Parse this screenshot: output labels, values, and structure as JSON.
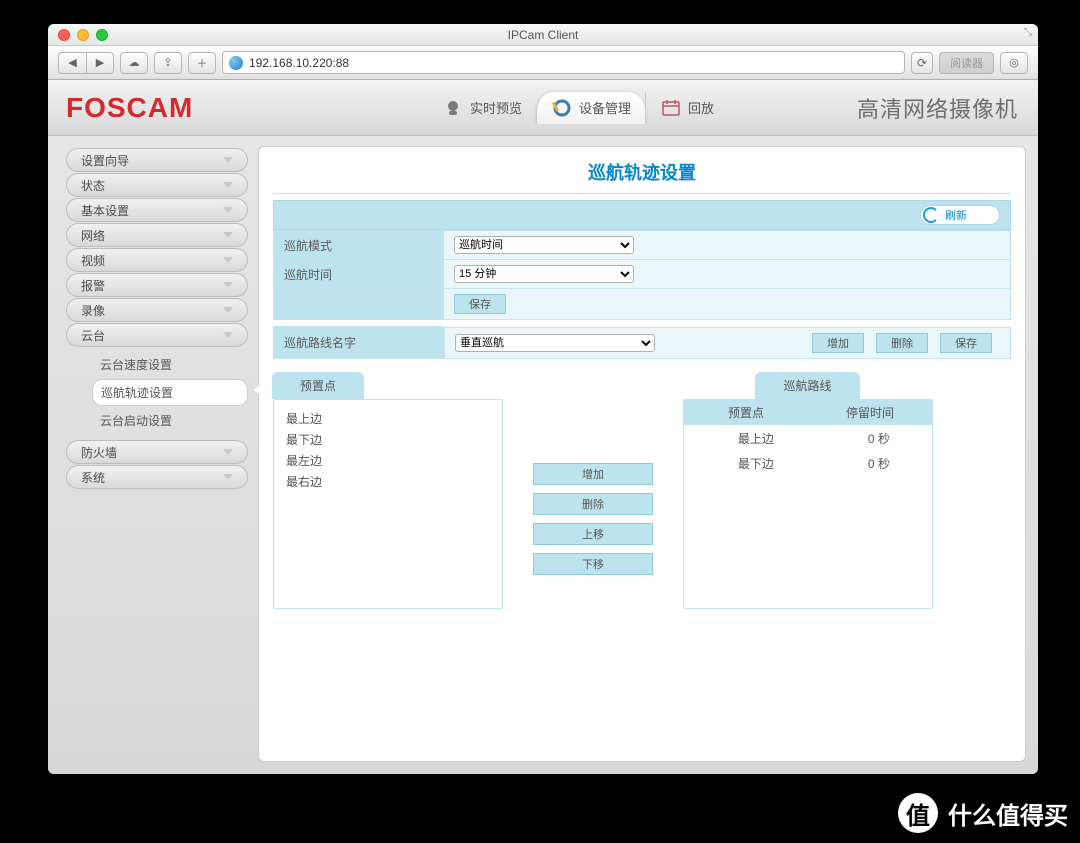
{
  "window": {
    "title": "IPCam Client"
  },
  "toolbar": {
    "url": "192.168.10.220:88",
    "reader": "阅读器"
  },
  "header": {
    "logo": "FOSCAM",
    "tabs": {
      "preview": "实时预览",
      "manage": "设备管理",
      "playback": "回放"
    },
    "product": "高清网络摄像机"
  },
  "sidebar": {
    "items": {
      "wizard": "设置向导",
      "status": "状态",
      "basic": "基本设置",
      "network": "网络",
      "video": "视频",
      "alarm": "报警",
      "record": "录像",
      "ptz": "云台",
      "firewall": "防火墙",
      "system": "系统"
    },
    "ptz_sub": {
      "speed": "云台速度设置",
      "cruise": "巡航轨迹设置",
      "startup": "云台启动设置"
    }
  },
  "page": {
    "title": "巡航轨迹设置",
    "refresh": "刷新",
    "fields": {
      "mode_label": "巡航模式",
      "mode_value": "巡航时间",
      "time_label": "巡航时间",
      "time_value": "15 分钟",
      "save": "保存",
      "route_label": "巡航路线名字",
      "route_value": "垂直巡航",
      "add": "增加",
      "delete": "删除",
      "save2": "保存"
    },
    "preset": {
      "title": "预置点",
      "items": [
        "最上边",
        "最下边",
        "最左边",
        "最右边"
      ]
    },
    "mid": {
      "add": "增加",
      "delete": "删除",
      "up": "上移",
      "down": "下移"
    },
    "route": {
      "title": "巡航路线",
      "col_preset": "预置点",
      "col_stay": "停留时间",
      "rows": [
        {
          "preset": "最上边",
          "stay": "0 秒"
        },
        {
          "preset": "最下边",
          "stay": "0 秒"
        }
      ]
    }
  },
  "watermark": {
    "badge": "值",
    "text": "什么值得买"
  }
}
